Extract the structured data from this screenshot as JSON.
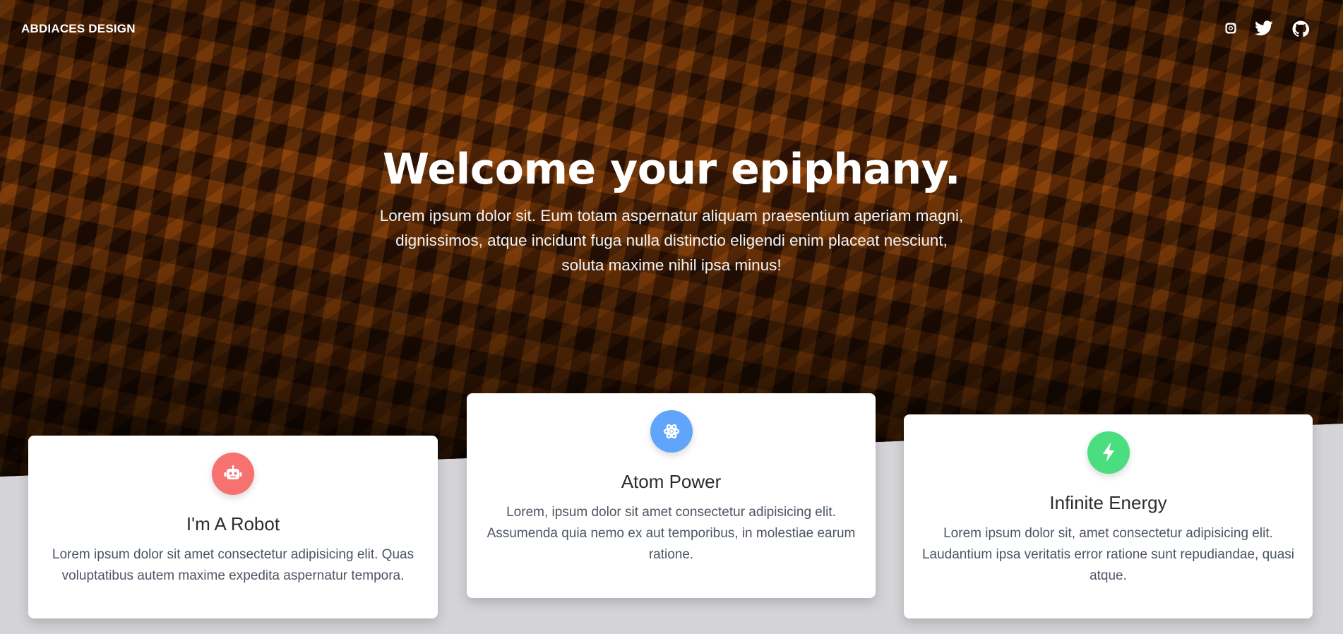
{
  "nav": {
    "brand": "ABDIACES DESIGN",
    "social": [
      {
        "name": "instagram-icon"
      },
      {
        "name": "twitter-icon"
      },
      {
        "name": "github-icon"
      }
    ]
  },
  "hero": {
    "title": "Welcome your epiphany.",
    "subtitle": "Lorem ipsum dolor sit. Eum totam aspernatur aliquam praesentium aperiam magni, dignissimos, atque incidunt fuga nulla distinctio eligendi enim placeat nesciunt, soluta maxime nihil ipsa minus!"
  },
  "cards": [
    {
      "icon": "robot-icon",
      "color": "#f87171",
      "title": "I'm A Robot",
      "text": "Lorem ipsum dolor sit amet consectetur adipisicing elit. Quas voluptatibus autem maxime expedita aspernatur tempora."
    },
    {
      "icon": "atom-icon",
      "color": "#60a5fa",
      "title": "Atom Power",
      "text": "Lorem, ipsum dolor sit amet consectetur adipisicing elit. Assumenda quia nemo ex aut temporibus, in molestiae earum ratione."
    },
    {
      "icon": "bolt-icon",
      "color": "#4ade80",
      "title": "Infinite Energy",
      "text": "Lorem ipsum dolor sit, amet consectetur adipisicing elit. Laudantium ipsa veritatis error ratione sunt repudiandae, quasi atque."
    }
  ]
}
